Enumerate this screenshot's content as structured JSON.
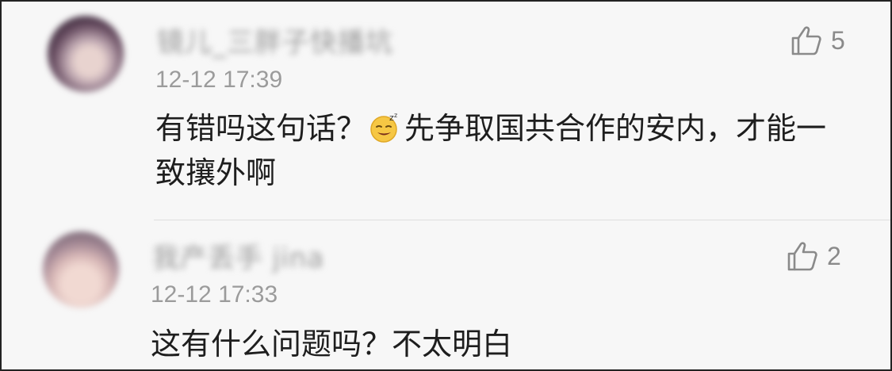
{
  "comments": [
    {
      "username": "镜儿_三胖子快播坑",
      "time": "12-12 17:39",
      "text_before_emoji": "有错吗这句话？",
      "emoji": "sleepy-face-emoji",
      "text_after_emoji": "先争取国共合作的安内，才能一致攘外啊",
      "likes": "5"
    },
    {
      "username": "我产丢手 jina",
      "time": "12-12 17:33",
      "text": "这有什么问题吗？不太明白",
      "likes": "2"
    }
  ],
  "icons": {
    "like": "thumbs-up-icon"
  },
  "colors": {
    "background": "#f7f7f7",
    "text": "#1e1e1e",
    "meta": "#9b9b9b"
  }
}
